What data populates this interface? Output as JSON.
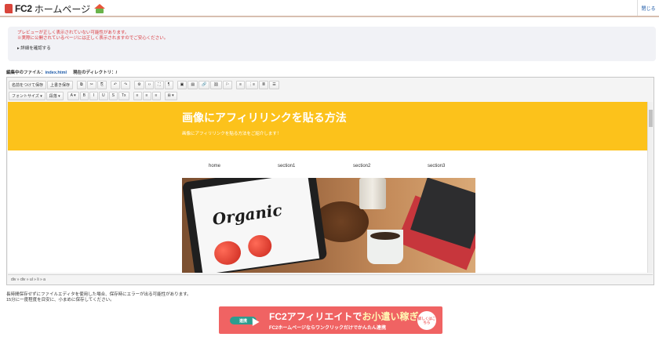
{
  "header": {
    "brand": "FC2",
    "subtitle": "ホームページ",
    "close_label": "閉じる"
  },
  "notice": {
    "line1": "プレビューが正しく表示されていない可能性があります。",
    "line2": "※実際に公開されているページには正しく表示されますのでご安心ください。",
    "details": "▸ 詳細を確認する"
  },
  "file": {
    "editing_label": "編集中のファイル：",
    "filename": "index.html",
    "dir_label": "現在のディレクトリ：/"
  },
  "toolbar": {
    "row1": [
      "名前をつけて保存",
      "上書き保存",
      "⧉",
      "✂",
      "⎘",
      "↶",
      "↷",
      "⚙",
      "‹›",
      "⛶",
      "¶",
      "▣",
      "▤",
      "🔗",
      "⛓",
      "⚐",
      "≡",
      "⋮≡",
      "≣",
      "☰"
    ],
    "row2": [
      "フォントサイズ ▾",
      "段落 ▾",
      "A ▾",
      "B",
      "I",
      "U",
      "S",
      "Tx",
      "≡",
      "≡",
      "≡",
      "⊞ ▾"
    ]
  },
  "page": {
    "title": "画像にアフィリリンクを貼る方法",
    "subtitle": "画像にアフィリリンクを貼る方法をご紹介します！",
    "nav": [
      "home",
      "section1",
      "section2",
      "section3"
    ],
    "image_text": "Organic"
  },
  "status": {
    "path": "div » div » ul » li » a"
  },
  "warning": {
    "line1": "長時間保存せずにファイルエディタを使用した場合、保存時にエラーが出る可能性があります。",
    "line2": "15分に一度程度を目安に、小まめに保存してください。"
  },
  "ad": {
    "pill": "連携",
    "headline_a": "FC2アフィリエイトで",
    "headline_b": "お小遣い稼ぎ",
    "sub": "FC2ホームページならワンクリックだけでかんたん連携",
    "badge": "詳しくはこちら"
  },
  "colors": {
    "banner": "#fcc21b",
    "ad": "#f06363",
    "alert": "#d9343a",
    "link": "#1d5aa8"
  }
}
